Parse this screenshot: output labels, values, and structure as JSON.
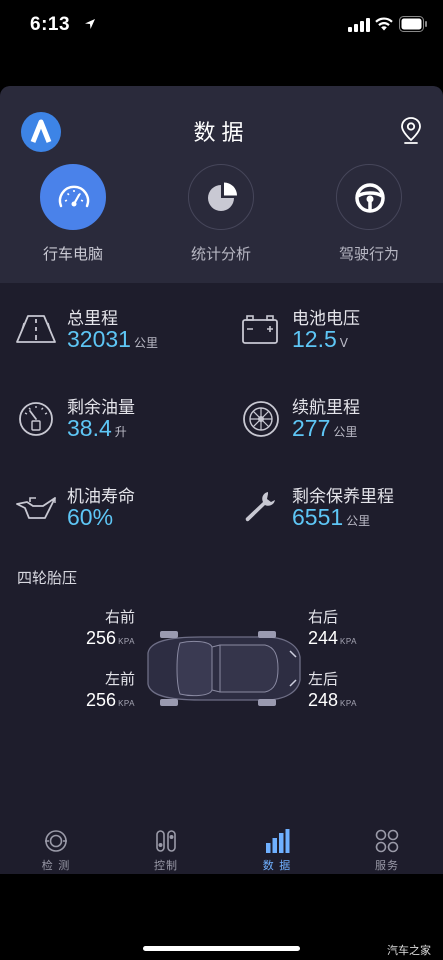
{
  "status_bar": {
    "time": "6:13"
  },
  "header": {
    "title": "数据"
  },
  "quick_nav": [
    {
      "label": "行车电脑",
      "active": true
    },
    {
      "label": "统计分析",
      "active": false
    },
    {
      "label": "驾驶行为",
      "active": false
    }
  ],
  "stats": {
    "mileage": {
      "title": "总里程",
      "value": "32031",
      "unit": "公里"
    },
    "voltage": {
      "title": "电池电压",
      "value": "12.5",
      "unit": "V"
    },
    "fuel": {
      "title": "剩余油量",
      "value": "38.4",
      "unit": "升"
    },
    "range": {
      "title": "续航里程",
      "value": "277",
      "unit": "公里"
    },
    "oil": {
      "title": "机油寿命",
      "value": "60%",
      "unit": ""
    },
    "service": {
      "title": "剩余保养里程",
      "value": "6551",
      "unit": "公里"
    }
  },
  "tires": {
    "title": "四轮胎压",
    "front_right": {
      "label": "右前",
      "value": "256",
      "unit": "KPA"
    },
    "front_left": {
      "label": "左前",
      "value": "256",
      "unit": "KPA"
    },
    "rear_right": {
      "label": "右后",
      "value": "244",
      "unit": "KPA"
    },
    "rear_left": {
      "label": "左后",
      "value": "248",
      "unit": "KPA"
    }
  },
  "tabs": [
    {
      "label": "检 测",
      "icon": "scan-icon"
    },
    {
      "label": "控制",
      "icon": "control-icon"
    },
    {
      "label": "数 据",
      "icon": "chart-icon",
      "active": true
    },
    {
      "label": "服务",
      "icon": "grid-icon"
    }
  ],
  "watermark": "汽车之家",
  "colors": {
    "accent": "#4a82ea",
    "value": "#5ec6f5",
    "background": "#1e1d2c",
    "panel": "#2a2a3b"
  }
}
